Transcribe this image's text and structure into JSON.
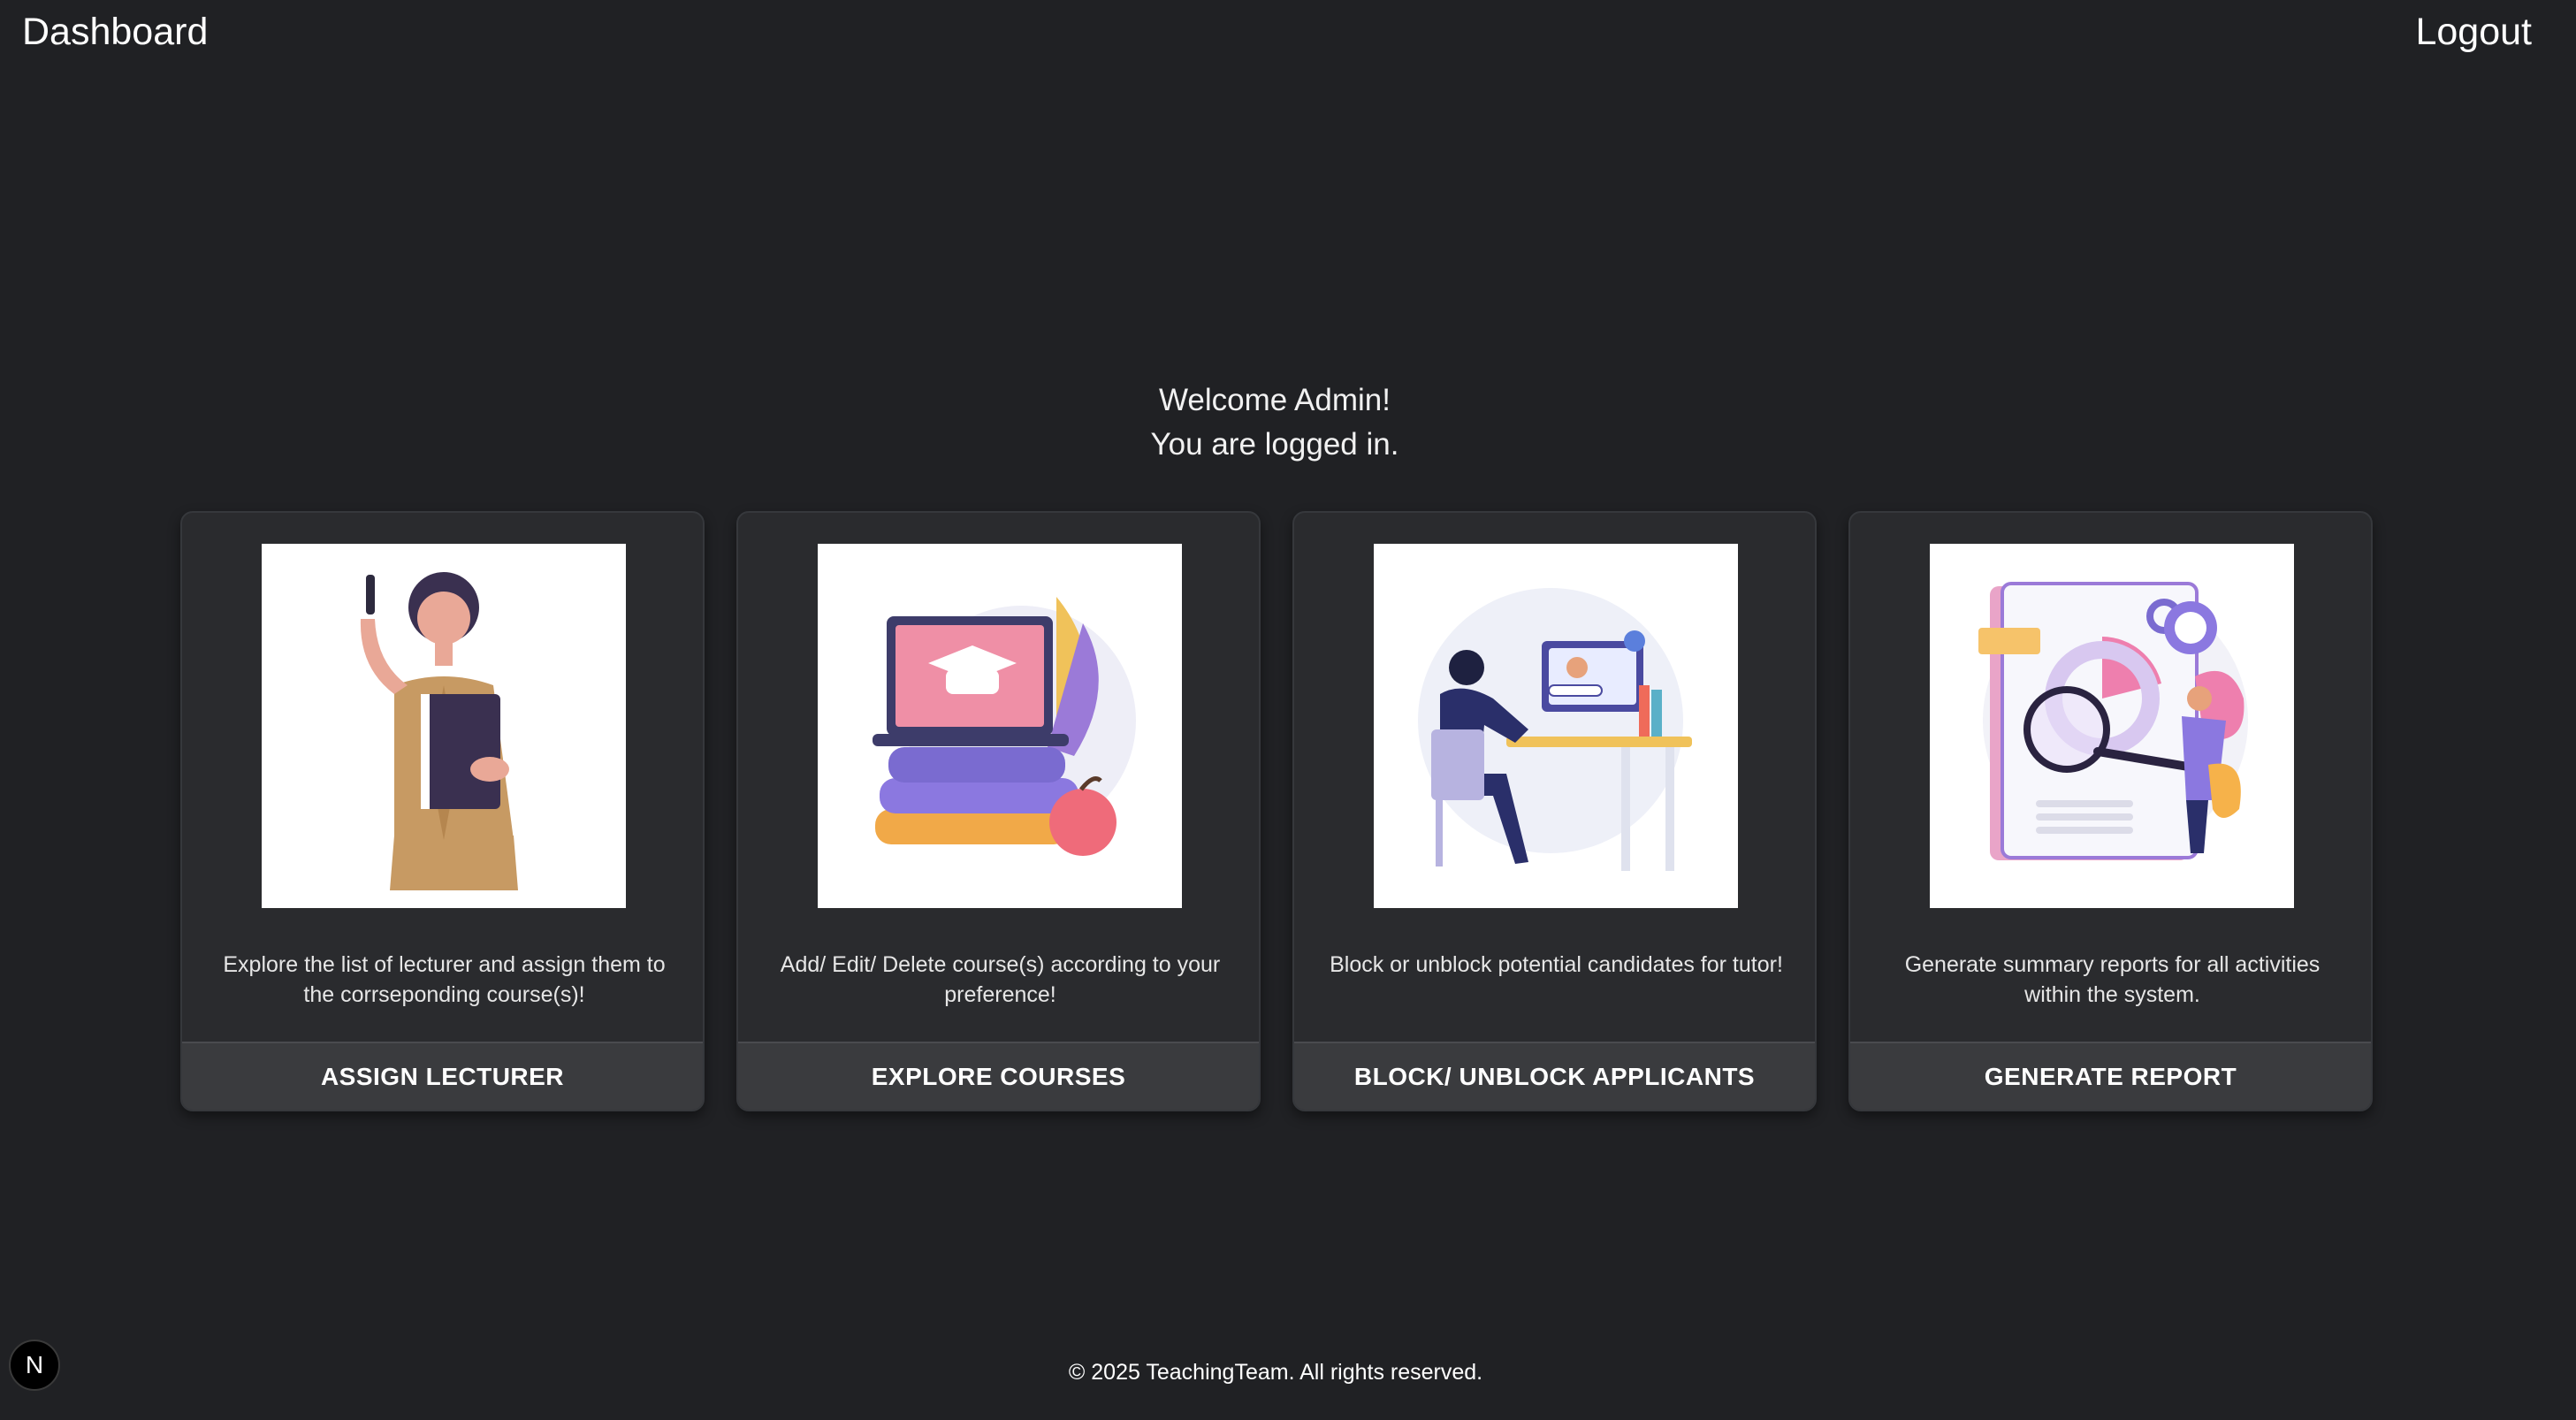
{
  "header": {
    "title": "Dashboard",
    "logout_label": "Logout"
  },
  "welcome": {
    "line1": "Welcome Admin!",
    "line2": "You are logged in."
  },
  "cards": [
    {
      "description": "Explore the list of lecturer and assign them to the corrseponding course(s)!",
      "action": "ASSIGN LECTURER",
      "image_icon": "lecturer-illustration"
    },
    {
      "description": "Add/ Edit/ Delete course(s) according to your preference!",
      "action": "EXPLORE COURSES",
      "image_icon": "courses-illustration"
    },
    {
      "description": "Block or unblock potential candidates for tutor!",
      "action": "BLOCK/ UNBLOCK APPLICANTS",
      "image_icon": "applicants-illustration"
    },
    {
      "description": "Generate summary reports for all activities within the system.",
      "action": "GENERATE REPORT",
      "image_icon": "report-illustration"
    }
  ],
  "footer": {
    "text": "© 2025 TeachingTeam. All rights reserved."
  },
  "dev_badge": {
    "label": "N",
    "icon": "nextjs-icon"
  },
  "colors": {
    "background": "#202124",
    "card": "#2a2b2e",
    "card_action": "#3a3b3e",
    "text": "#ffffff"
  }
}
